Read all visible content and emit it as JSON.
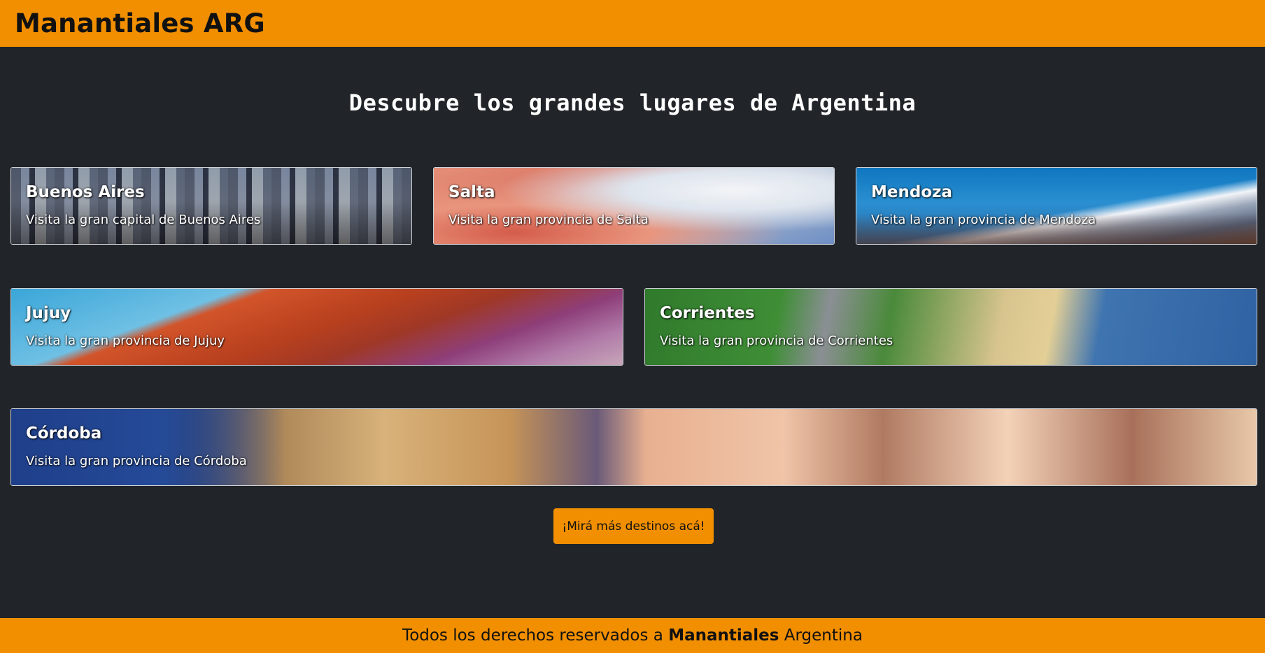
{
  "navbar": {
    "brand": "Manantiales ARG"
  },
  "main": {
    "headline": "Descubre los grandes lugares de Argentina"
  },
  "destinations": [
    {
      "title": "Buenos Aires",
      "subtitle": "Visita la gran capital de Buenos Aires"
    },
    {
      "title": "Salta",
      "subtitle": "Visita la gran provincia de Salta"
    },
    {
      "title": "Mendoza",
      "subtitle": "Visita la gran provincia de Mendoza"
    },
    {
      "title": "Jujuy",
      "subtitle": "Visita la gran provincia de Jujuy"
    },
    {
      "title": "Corrientes",
      "subtitle": "Visita la gran provincia de Corrientes"
    },
    {
      "title": "Córdoba",
      "subtitle": "Visita la gran provincia de Córdoba"
    }
  ],
  "more_button": {
    "label": "¡Mirá más destinos acá!"
  },
  "footer": {
    "prefix": "Todos los derechos reservados a ",
    "brand": "Manantiales",
    "suffix": " Argentina"
  },
  "colors": {
    "accent": "#f18f00",
    "background": "#212529",
    "text_on_accent": "#111111"
  }
}
